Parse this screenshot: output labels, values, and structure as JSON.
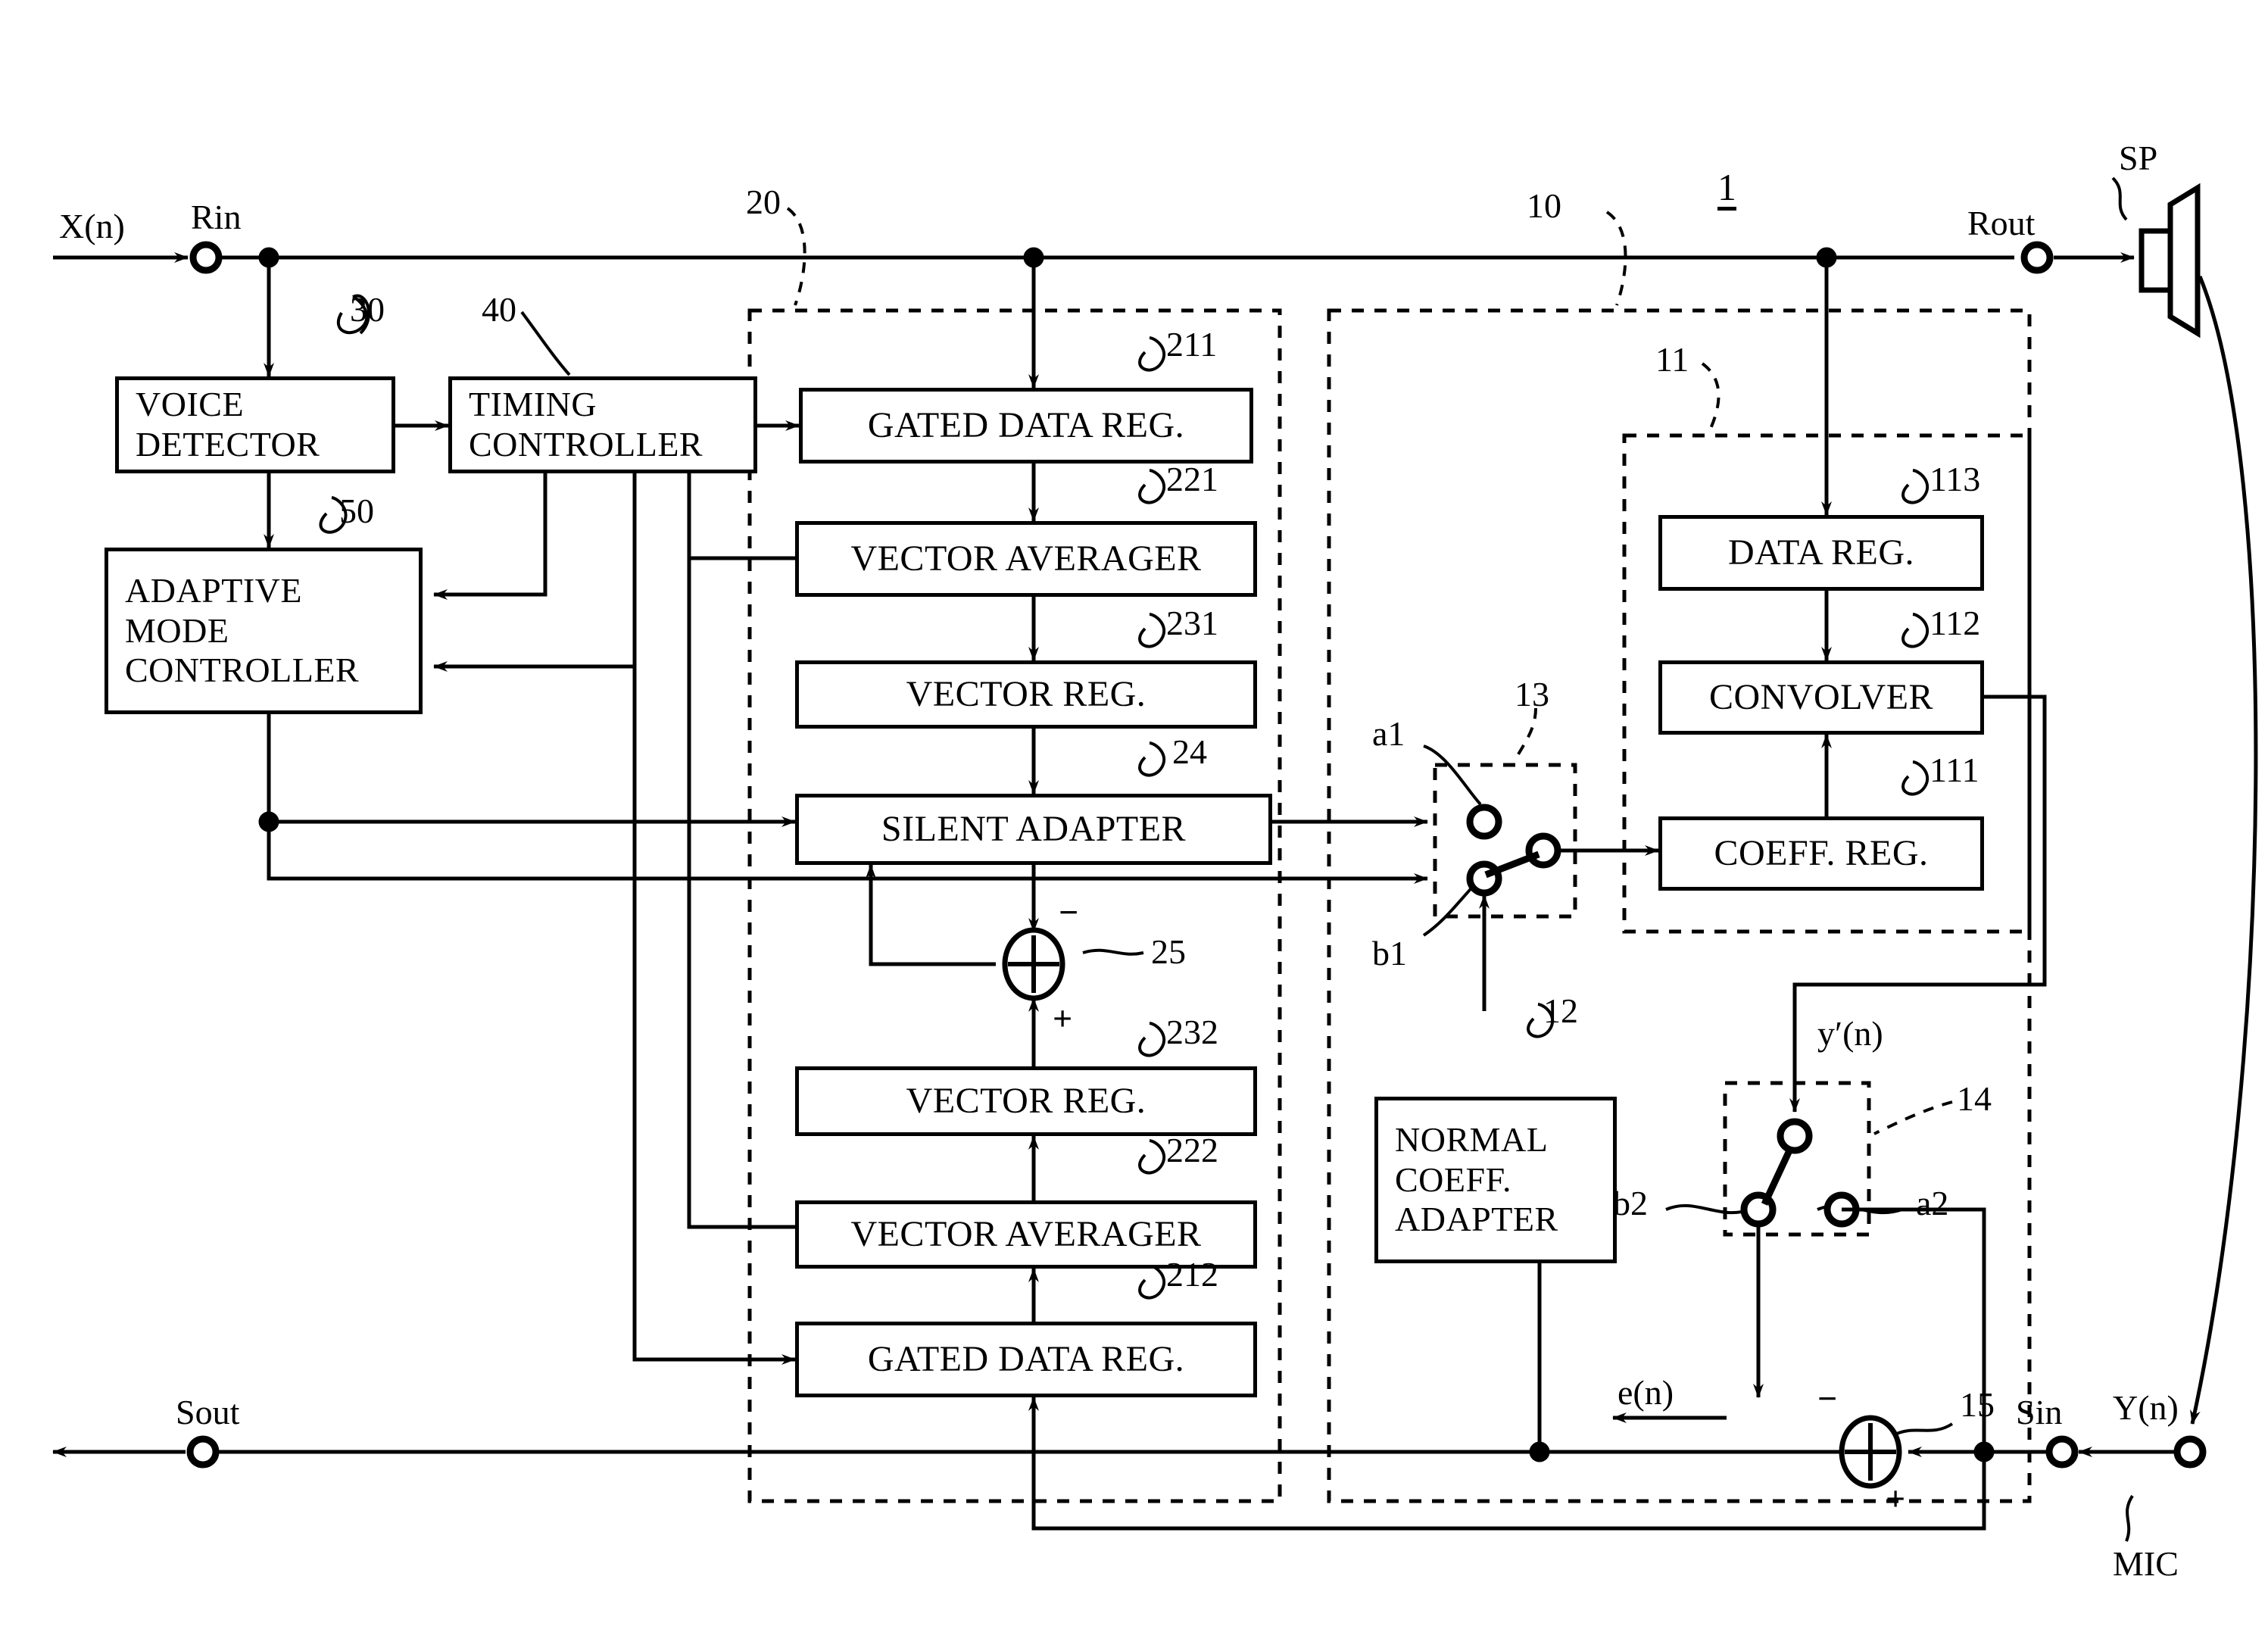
{
  "figure": {
    "overall_ref": "1",
    "title_ref": "1"
  },
  "ports": {
    "x_in_signal": "X(n)",
    "rin": "Rin",
    "rout": "Rout",
    "speaker": "SP",
    "sout": "Sout",
    "sin": "Sin",
    "y_in_signal": "Y(n)",
    "mic": "MIC",
    "error_signal": "e(n)",
    "y_prime_signal": "y′(n)"
  },
  "blocks": [
    {
      "id": "voice-detector",
      "ref": "30",
      "lines": [
        "VOICE",
        "DETECTOR"
      ]
    },
    {
      "id": "timing-controller",
      "ref": "40",
      "lines": [
        "TIMING",
        "CONTROLLER"
      ]
    },
    {
      "id": "adaptive-mode-controller",
      "ref": "50",
      "lines": [
        "ADAPTIVE",
        "MODE",
        "CONTROLLER"
      ]
    },
    {
      "id": "gated-data-reg-211",
      "ref": "211",
      "lines": [
        "GATED DATA REG."
      ]
    },
    {
      "id": "vector-averager-221",
      "ref": "221",
      "lines": [
        "VECTOR AVERAGER"
      ]
    },
    {
      "id": "vector-reg-231",
      "ref": "231",
      "lines": [
        "VECTOR REG."
      ]
    },
    {
      "id": "silent-adapter-24",
      "ref": "24",
      "lines": [
        "SILENT ADAPTER"
      ]
    },
    {
      "id": "vector-reg-232",
      "ref": "232",
      "lines": [
        "VECTOR REG."
      ]
    },
    {
      "id": "vector-averager-222",
      "ref": "222",
      "lines": [
        "VECTOR AVERAGER"
      ]
    },
    {
      "id": "gated-data-reg-212",
      "ref": "212",
      "lines": [
        "GATED DATA REG."
      ]
    },
    {
      "id": "normal-coeff-adapter",
      "ref": "12",
      "lines": [
        "NORMAL",
        "COEFF.",
        "ADAPTER"
      ]
    },
    {
      "id": "data-reg-113",
      "ref": "113",
      "lines": [
        "DATA REG."
      ]
    },
    {
      "id": "convolver-112",
      "ref": "112",
      "lines": [
        "CONVOLVER"
      ]
    },
    {
      "id": "coeff-reg-111",
      "ref": "111",
      "lines": [
        "COEFF. REG."
      ]
    }
  ],
  "dashed_groups": [
    {
      "id": "group-20",
      "ref": "20"
    },
    {
      "id": "group-10",
      "ref": "10"
    },
    {
      "id": "group-11",
      "ref": "11"
    },
    {
      "id": "switch-13",
      "ref": "13"
    },
    {
      "id": "switch-14",
      "ref": "14"
    }
  ],
  "adders": [
    {
      "id": "adder-25",
      "ref": "25",
      "minus": "−",
      "plus": "+"
    },
    {
      "id": "adder-15",
      "ref": "15",
      "minus": "−",
      "plus": "+"
    }
  ],
  "switch_terminals": {
    "a1": "a1",
    "b1": "b1",
    "a2": "a2",
    "b2": "b2"
  },
  "colors": {
    "ink": "#000000",
    "paper": "#ffffff"
  }
}
